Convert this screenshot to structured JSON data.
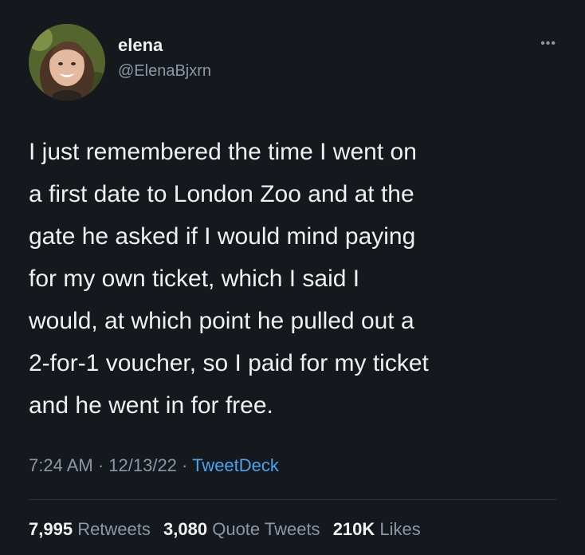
{
  "author": {
    "name": "elena",
    "handle": "@ElenaBjxrn"
  },
  "icons": {
    "more": "more-options-icon",
    "avatar": "profile-photo"
  },
  "tweet": {
    "text": "I just remembered the time I went on\na first date to London Zoo and at the\ngate he asked if I would mind paying\nfor my own ticket, which I said I\nwould, at which point he pulled out a\n2-for-1 voucher, so I paid for my ticket\nand he went in for free."
  },
  "meta": {
    "time": "7:24 AM",
    "separator": " · ",
    "date": "12/13/22",
    "source": "TweetDeck"
  },
  "stats": {
    "retweets_count": "7,995",
    "retweets_label": "Retweets",
    "quotes_count": "3,080",
    "quotes_label": "Quote Tweets",
    "likes_count": "210K",
    "likes_label": "Likes"
  },
  "colors": {
    "background": "#15181d",
    "text": "#eef0f1",
    "muted": "#8b98a5",
    "link": "#4aa3ee"
  }
}
